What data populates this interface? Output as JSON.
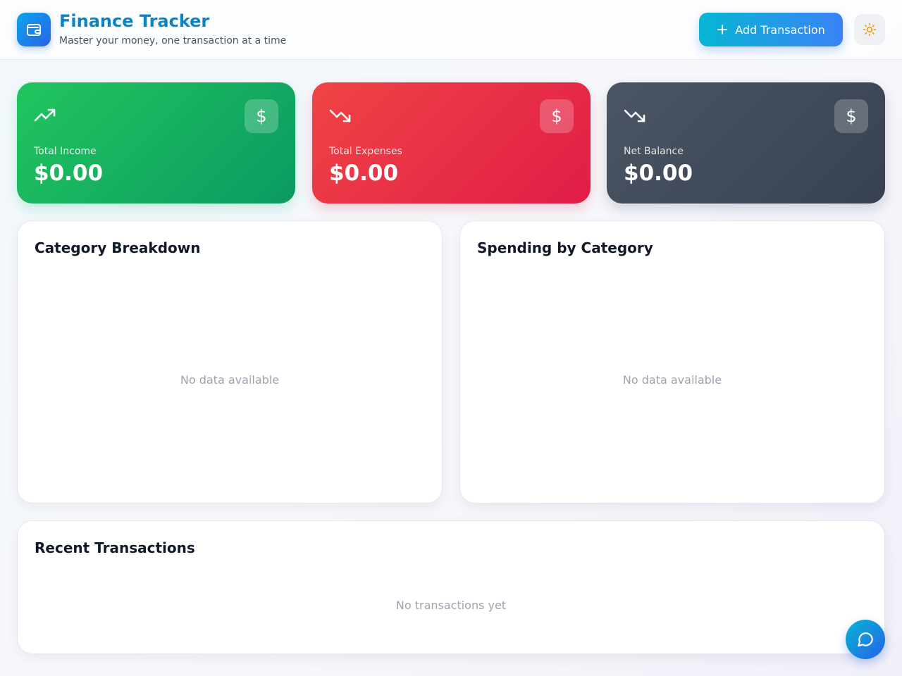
{
  "app": {
    "title": "Finance Tracker",
    "subtitle": "Master your money, one transaction at a time",
    "logo_icon": "wallet-icon"
  },
  "header": {
    "add_button_label": "Add Transaction",
    "add_button_icon": "plus-icon",
    "theme_toggle_icon": "sun-icon"
  },
  "stats": {
    "income": {
      "label": "Total Income",
      "value": "$0.00",
      "icon": "trending-up-icon",
      "color": "#16a34a"
    },
    "expenses": {
      "label": "Total Expenses",
      "value": "$0.00",
      "icon": "trending-down-icon",
      "color": "#e11d48"
    },
    "balance": {
      "label": "Net Balance",
      "value": "$0.00",
      "icon": "trending-down-icon",
      "color": "#374151"
    }
  },
  "panels": {
    "category_breakdown": {
      "title": "Category Breakdown",
      "empty": "No data available"
    },
    "spending_by_category": {
      "title": "Spending by Category",
      "empty": "No data available"
    },
    "recent_transactions": {
      "title": "Recent Transactions",
      "empty": "No transactions yet"
    }
  },
  "chat": {
    "icon": "chat-icon"
  }
}
